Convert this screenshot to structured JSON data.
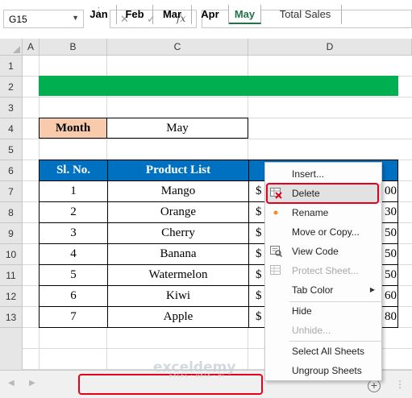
{
  "formula_bar": {
    "name_box": "G15",
    "cancel_icon": "x-icon",
    "enter_icon": "check-icon",
    "fx_label": "fx",
    "formula": ""
  },
  "columns": [
    "A",
    "B",
    "C",
    "D"
  ],
  "rows": [
    "1",
    "2",
    "3",
    "4",
    "5",
    "6",
    "7",
    "8",
    "9",
    "10",
    "11",
    "12",
    "13"
  ],
  "month_label": "Month",
  "month_value": "May",
  "table": {
    "headers": [
      "Sl. No.",
      "Product List",
      ""
    ],
    "rows": [
      {
        "sl": "1",
        "product": "Mango",
        "currency": "$",
        "amount_tail": "00"
      },
      {
        "sl": "2",
        "product": "Orange",
        "currency": "$",
        "amount_tail": "30"
      },
      {
        "sl": "3",
        "product": "Cherry",
        "currency": "$",
        "amount_tail": "50"
      },
      {
        "sl": "4",
        "product": "Banana",
        "currency": "$",
        "amount_tail": "50"
      },
      {
        "sl": "5",
        "product": "Watermelon",
        "currency": "$",
        "amount_tail": "50"
      },
      {
        "sl": "6",
        "product": "Kiwi",
        "currency": "$",
        "amount_tail": "60"
      },
      {
        "sl": "7",
        "product": "Apple",
        "currency": "$",
        "amount_tail": "80"
      }
    ]
  },
  "context_menu": {
    "items": [
      {
        "label": "Insert...",
        "disabled": false,
        "icon": ""
      },
      {
        "label": "Delete",
        "disabled": false,
        "icon": "delete-sheet-icon"
      },
      {
        "label": "Rename",
        "disabled": false,
        "icon": "dot-icon"
      },
      {
        "label": "Move or Copy...",
        "disabled": false,
        "icon": ""
      },
      {
        "label": "View Code",
        "disabled": false,
        "icon": "view-code-icon"
      },
      {
        "label": "Protect Sheet...",
        "disabled": true,
        "icon": "protect-sheet-icon"
      },
      {
        "label": "Tab Color",
        "disabled": false,
        "icon": ""
      },
      {
        "label": "Hide",
        "disabled": false,
        "icon": ""
      },
      {
        "label": "Unhide...",
        "disabled": true,
        "icon": ""
      },
      {
        "label": "Select All Sheets",
        "disabled": false,
        "icon": ""
      },
      {
        "label": "Ungroup Sheets",
        "disabled": false,
        "icon": ""
      }
    ]
  },
  "sheet_tabs": {
    "tabs": [
      "Jan",
      "Feb",
      "Mar",
      "Apr",
      "May",
      "Total Sales"
    ],
    "active": "May"
  },
  "watermark": {
    "name": "exceldemy",
    "tagline": "EXCEL · DATA · BI"
  },
  "colors": {
    "green_bar": "#00b050",
    "month_label_fill": "#f8cbad",
    "header_fill": "#0070c0",
    "highlight_red": "#e2001a",
    "active_tab_text": "#217346"
  }
}
